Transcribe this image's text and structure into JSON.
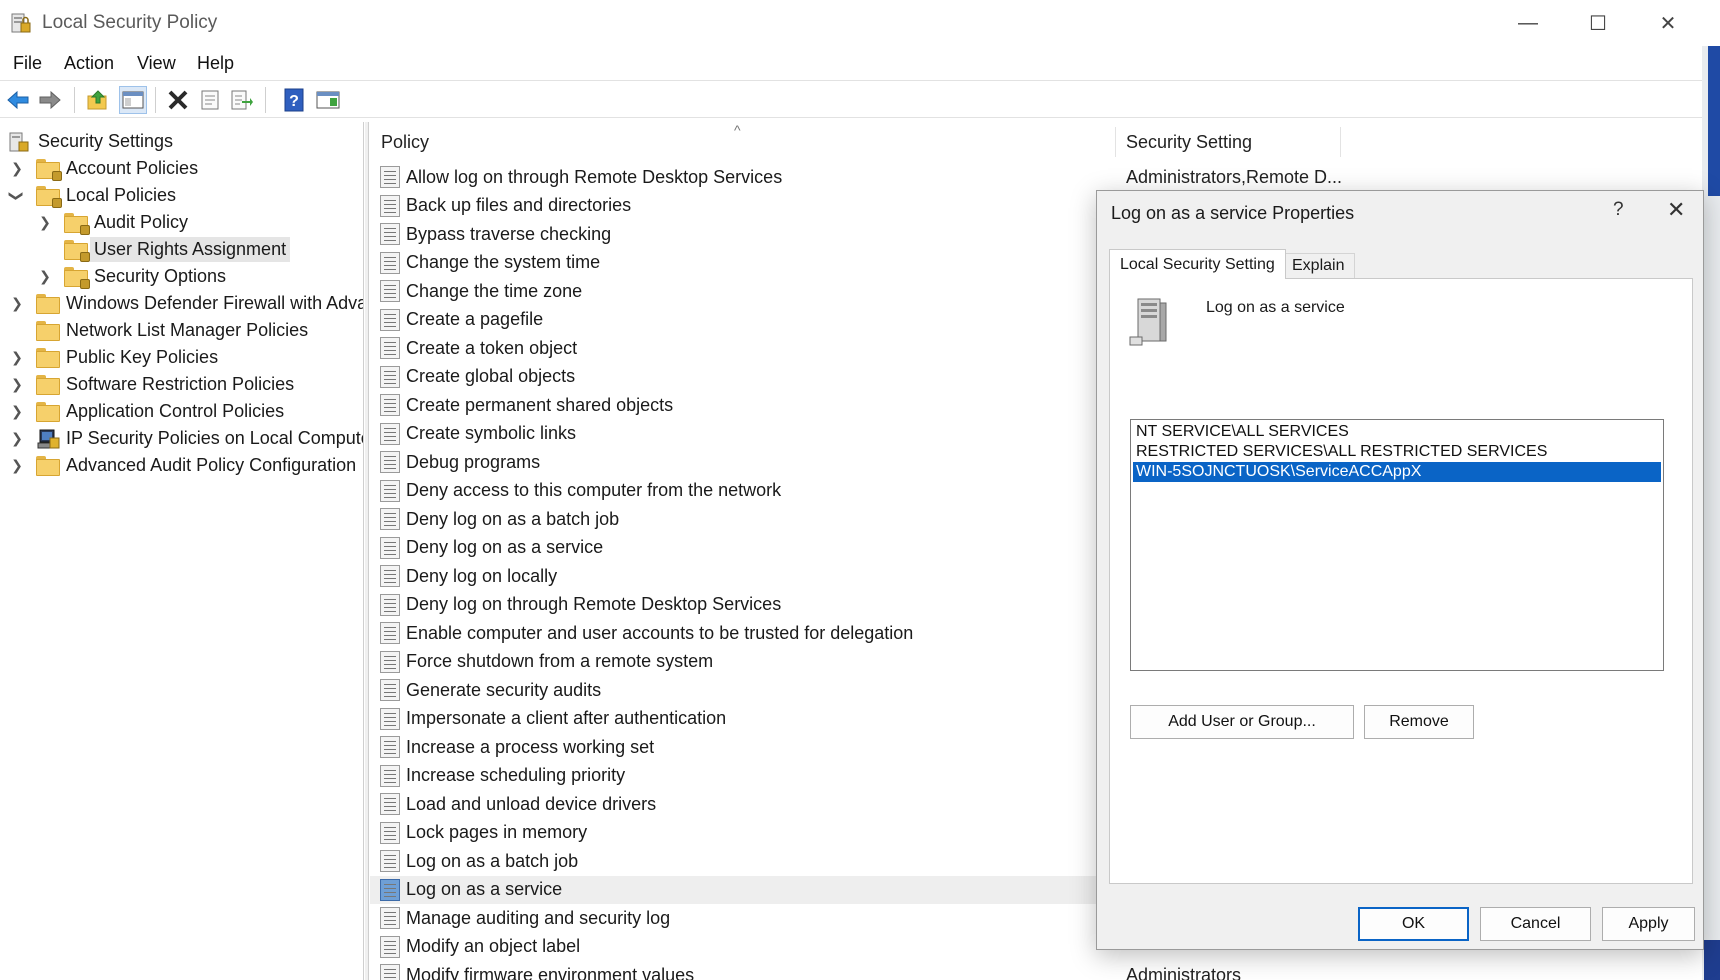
{
  "window": {
    "title": "Local Security Policy",
    "minimize_glyph": "—",
    "maximize_glyph": "☐",
    "close_glyph": "✕"
  },
  "menu": {
    "items": [
      "File",
      "Action",
      "View",
      "Help"
    ]
  },
  "toolbar": {
    "buttons": [
      "back-icon",
      "forward-icon",
      "up-folder-icon",
      "show-hide-console-tree-icon",
      "delete-icon",
      "properties-icon",
      "export-list-icon",
      "help-icon",
      "show-action-pane-icon"
    ],
    "pressed": "show-hide-console-tree-icon"
  },
  "tree": {
    "root": "Security Settings",
    "items": [
      {
        "label": "Account Policies",
        "expanded": false
      },
      {
        "label": "Local Policies",
        "expanded": true
      },
      {
        "label": "Audit Policy",
        "expanded": false
      },
      {
        "label": "User Rights Assignment",
        "selected": true
      },
      {
        "label": "Security Options",
        "expanded": false
      },
      {
        "label": "Windows Defender Firewall with Advan",
        "expanded": false
      },
      {
        "label": "Network List Manager Policies"
      },
      {
        "label": "Public Key Policies",
        "expanded": false
      },
      {
        "label": "Software Restriction Policies",
        "expanded": false
      },
      {
        "label": "Application Control Policies",
        "expanded": false
      },
      {
        "label": "IP Security Policies on Local Computer",
        "expanded": false
      },
      {
        "label": "Advanced Audit Policy Configuration",
        "expanded": false
      }
    ]
  },
  "list": {
    "columns": [
      "Policy",
      "Security Setting"
    ],
    "sort_glyph": "^",
    "rows": [
      {
        "policy": "Allow log on through Remote Desktop Services",
        "setting": "Administrators,Remote D..."
      },
      {
        "policy": "Back up files and directories",
        "setting": ""
      },
      {
        "policy": "Bypass traverse checking",
        "setting": ""
      },
      {
        "policy": "Change the system time",
        "setting": ""
      },
      {
        "policy": "Change the time zone",
        "setting": ""
      },
      {
        "policy": "Create a pagefile",
        "setting": ""
      },
      {
        "policy": "Create a token object",
        "setting": ""
      },
      {
        "policy": "Create global objects",
        "setting": ""
      },
      {
        "policy": "Create permanent shared objects",
        "setting": ""
      },
      {
        "policy": "Create symbolic links",
        "setting": ""
      },
      {
        "policy": "Debug programs",
        "setting": ""
      },
      {
        "policy": "Deny access to this computer from the network",
        "setting": ""
      },
      {
        "policy": "Deny log on as a batch job",
        "setting": ""
      },
      {
        "policy": "Deny log on as a service",
        "setting": ""
      },
      {
        "policy": "Deny log on locally",
        "setting": ""
      },
      {
        "policy": "Deny log on through Remote Desktop Services",
        "setting": ""
      },
      {
        "policy": "Enable computer and user accounts to be trusted for delegation",
        "setting": ""
      },
      {
        "policy": "Force shutdown from a remote system",
        "setting": ""
      },
      {
        "policy": "Generate security audits",
        "setting": ""
      },
      {
        "policy": "Impersonate a client after authentication",
        "setting": ""
      },
      {
        "policy": "Increase a process working set",
        "setting": ""
      },
      {
        "policy": "Increase scheduling priority",
        "setting": ""
      },
      {
        "policy": "Load and unload device drivers",
        "setting": ""
      },
      {
        "policy": "Lock pages in memory",
        "setting": ""
      },
      {
        "policy": "Log on as a batch job",
        "setting": ""
      },
      {
        "policy": "Log on as a service",
        "setting": "",
        "selected": true
      },
      {
        "policy": "Manage auditing and security log",
        "setting": ""
      },
      {
        "policy": "Modify an object label",
        "setting": ""
      },
      {
        "policy": "Modify firmware environment values",
        "setting": "Administrators"
      }
    ]
  },
  "dialog": {
    "title": "Log on as a service Properties",
    "help_glyph": "?",
    "close_glyph": "✕",
    "tabs": [
      "Local Security Setting",
      "Explain"
    ],
    "active_tab": "Local Security Setting",
    "policy_name": "Log on as a service",
    "accounts": [
      {
        "name": "NT SERVICE\\ALL SERVICES"
      },
      {
        "name": "RESTRICTED SERVICES\\ALL RESTRICTED SERVICES"
      },
      {
        "name": "WIN-5SOJNCTUOSK\\ServiceACCAppX",
        "selected": true
      }
    ],
    "add_button": "Add User or Group...",
    "remove_button": "Remove",
    "ok_button": "OK",
    "cancel_button": "Cancel",
    "apply_button": "Apply"
  }
}
